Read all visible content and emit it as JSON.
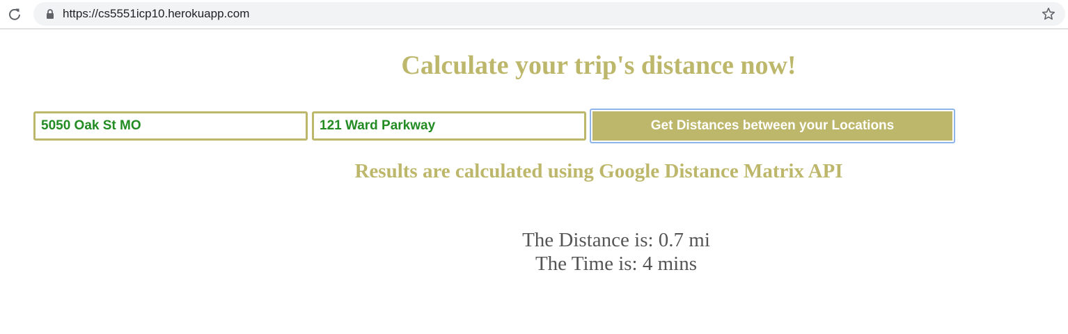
{
  "browser": {
    "url": "https://cs5551icp10.herokuapp.com"
  },
  "page": {
    "title": "Calculate your trip's distance now!",
    "origin": {
      "value": "5050 Oak St MO"
    },
    "destination": {
      "value": "121 Ward Parkway"
    },
    "submit_label": "Get Distances between your Locations",
    "results_note": "Results are calculated using Google Distance Matrix API",
    "result": {
      "distance": "The Distance is: 0.7 mi",
      "time": "The Time is: 4 mins"
    }
  },
  "colors": {
    "accent": "#bdb76b",
    "input_text": "#228b22",
    "result_text": "#555555"
  }
}
